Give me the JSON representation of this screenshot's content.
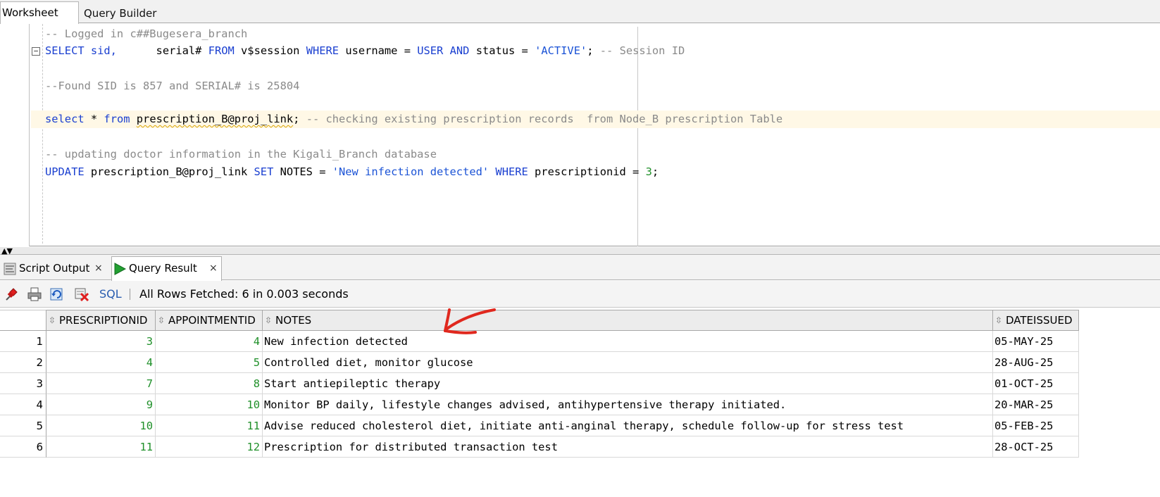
{
  "top_tabs": {
    "worksheet": "Worksheet",
    "query_builder": "Query Builder"
  },
  "editor": {
    "line1_comment": "-- Logged in c##Bugesera_branch",
    "line2": {
      "kw_select": "SELECT",
      "col_sid": " sid,",
      "rest1": "      serial# ",
      "kw_from": "FROM",
      "rest2": " v$session ",
      "kw_where": "WHERE",
      "rest3": " username = ",
      "kw_user": "USER",
      "sp": " ",
      "kw_and": "AND",
      "rest4": " status = ",
      "str_active": "'ACTIVE'",
      "rest5": "; ",
      "comment": "-- Session ID"
    },
    "line4_comment": "--Found SID is 857 and SERIAL# is 25804",
    "line6": {
      "kw_select": "select",
      "star": " * ",
      "kw_from": "from",
      "sp": " ",
      "table": "prescription_B@proj_link",
      "semi": "; ",
      "comment": "-- checking existing prescription records  from Node_B prescription Table"
    },
    "line8_comment": "-- updating doctor information in the Kigali_Branch database",
    "line9": {
      "kw_update": "UPDATE",
      "rest1": " prescription_B@proj_link ",
      "kw_set": "SET",
      "rest2": " NOTES = ",
      "str_val": "'New infection detected'",
      "sp": " ",
      "kw_where": "WHERE",
      "rest3": " prescriptionid = ",
      "num": "3",
      "semi": ";"
    }
  },
  "bottom_tabs": {
    "script_output": "Script Output",
    "query_result": "Query Result",
    "close": "×"
  },
  "toolbar": {
    "sql_label": "SQL",
    "status": "All Rows Fetched: 6 in 0.003 seconds",
    "icons": [
      "pin-icon",
      "print-icon",
      "refresh-icon",
      "delete-icon"
    ]
  },
  "grid": {
    "columns": [
      "PRESCRIPTIONID",
      "APPOINTMENTID",
      "NOTES",
      "DATEISSUED"
    ],
    "rows": [
      {
        "n": "1",
        "pid": "3",
        "aid": "4",
        "notes": "New infection detected",
        "date": "05-MAY-25"
      },
      {
        "n": "2",
        "pid": "4",
        "aid": "5",
        "notes": "Controlled diet, monitor glucose",
        "date": "28-AUG-25"
      },
      {
        "n": "3",
        "pid": "7",
        "aid": "8",
        "notes": "Start antiepileptic therapy",
        "date": "01-OCT-25"
      },
      {
        "n": "4",
        "pid": "9",
        "aid": "10",
        "notes": "Monitor BP daily, lifestyle changes advised, antihypertensive therapy initiated.",
        "date": "20-MAR-25"
      },
      {
        "n": "5",
        "pid": "10",
        "aid": "11",
        "notes": "Advise reduced cholesterol diet, initiate anti-anginal therapy, schedule follow-up for stress test",
        "date": "05-FEB-25"
      },
      {
        "n": "6",
        "pid": "11",
        "aid": "12",
        "notes": "Prescription for distributed transaction test",
        "date": "28-OCT-25"
      }
    ]
  },
  "colors": {
    "keyword": "#1a3fd0",
    "comment": "#8a8a8a",
    "string": "#1b53d6",
    "number": "#20902a",
    "annotation": "#e0281e",
    "line_highlight": "#fff8e6"
  }
}
